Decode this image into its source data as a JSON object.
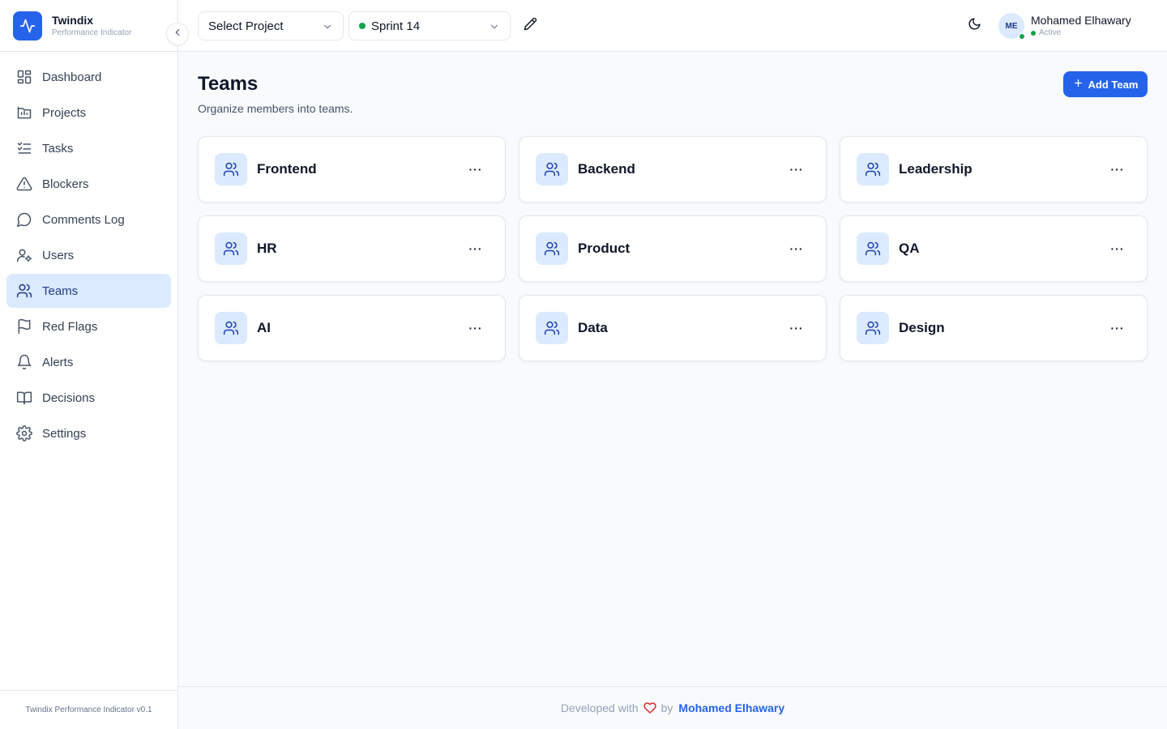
{
  "brand": {
    "name": "Twindix",
    "subtitle": "Performance Indicator"
  },
  "sidebar": {
    "items": [
      {
        "label": "Dashboard",
        "icon": "dashboard-icon"
      },
      {
        "label": "Projects",
        "icon": "projects-icon"
      },
      {
        "label": "Tasks",
        "icon": "tasks-icon"
      },
      {
        "label": "Blockers",
        "icon": "warning-icon"
      },
      {
        "label": "Comments Log",
        "icon": "comment-icon"
      },
      {
        "label": "Users",
        "icon": "users-settings-icon"
      },
      {
        "label": "Teams",
        "icon": "teams-icon",
        "active": true
      },
      {
        "label": "Red Flags",
        "icon": "flag-icon"
      },
      {
        "label": "Alerts",
        "icon": "bell-icon"
      },
      {
        "label": "Decisions",
        "icon": "book-icon"
      },
      {
        "label": "Settings",
        "icon": "gear-icon"
      }
    ],
    "footer": "Twindix Performance Indicator v0.1"
  },
  "topbar": {
    "project_select": "Select Project",
    "sprint_select": "Sprint 14",
    "user": {
      "initials": "ME",
      "name": "Mohamed Elhawary",
      "status": "Active"
    }
  },
  "main": {
    "title": "Teams",
    "subtitle": "Organize members into teams.",
    "add_label": "Add Team",
    "teams": [
      "Frontend",
      "Backend",
      "Leadership",
      "HR",
      "Product",
      "QA",
      "AI",
      "Data",
      "Design"
    ],
    "more_label": "···"
  },
  "footer": {
    "prefix": "Developed with",
    "by": "by",
    "author": "Mohamed Elhawary"
  },
  "colors": {
    "accent": "#2563eb",
    "active_bg": "#dbeafe",
    "status": "#16a34a",
    "heart": "#dc2626"
  }
}
